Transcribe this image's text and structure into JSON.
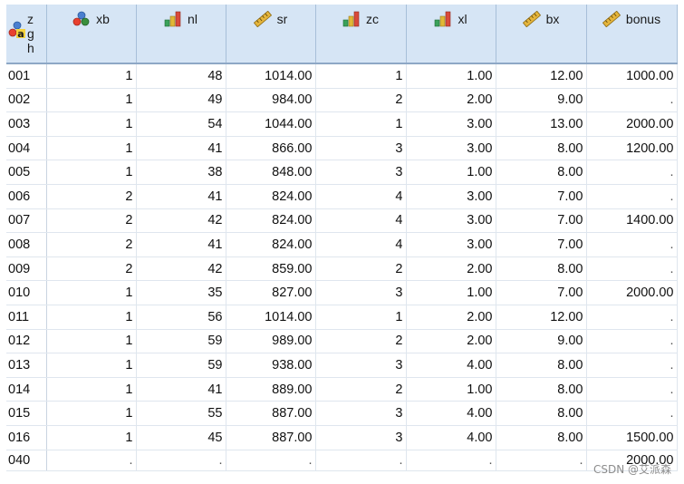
{
  "colors": {
    "header_bg": "#d6e5f5",
    "grid_line": "#dfe6ee",
    "nominal_icon": [
      "#e8402f",
      "#3a8f3d",
      "#4a7fd0"
    ],
    "ordinal_bar_colors": [
      "#3aa15a",
      "#e0b836",
      "#d94a3a"
    ],
    "scale_icon": "#e5b53c"
  },
  "header": {
    "corner_text": [
      "z",
      "g",
      "h"
    ],
    "corner_icon": "string-nominal-icon",
    "columns": [
      {
        "label": "xb",
        "icon": "nominal-icon"
      },
      {
        "label": "nl",
        "icon": "ordinal-icon"
      },
      {
        "label": "sr",
        "icon": "scale-ruler-icon"
      },
      {
        "label": "zc",
        "icon": "ordinal-icon"
      },
      {
        "label": "xl",
        "icon": "ordinal-icon"
      },
      {
        "label": "bx",
        "icon": "scale-ruler-icon"
      },
      {
        "label": "bonus",
        "icon": "scale-ruler-icon"
      }
    ]
  },
  "rows": [
    [
      "001",
      "1",
      "48",
      "1014.00",
      "1",
      "1.00",
      "12.00",
      "1000.00"
    ],
    [
      "002",
      "1",
      "49",
      "984.00",
      "2",
      "2.00",
      "9.00",
      "."
    ],
    [
      "003",
      "1",
      "54",
      "1044.00",
      "1",
      "3.00",
      "13.00",
      "2000.00"
    ],
    [
      "004",
      "1",
      "41",
      "866.00",
      "3",
      "3.00",
      "8.00",
      "1200.00"
    ],
    [
      "005",
      "1",
      "38",
      "848.00",
      "3",
      "1.00",
      "8.00",
      "."
    ],
    [
      "006",
      "2",
      "41",
      "824.00",
      "4",
      "3.00",
      "7.00",
      "."
    ],
    [
      "007",
      "2",
      "42",
      "824.00",
      "4",
      "3.00",
      "7.00",
      "1400.00"
    ],
    [
      "008",
      "2",
      "41",
      "824.00",
      "4",
      "3.00",
      "7.00",
      "."
    ],
    [
      "009",
      "2",
      "42",
      "859.00",
      "2",
      "2.00",
      "8.00",
      "."
    ],
    [
      "010",
      "1",
      "35",
      "827.00",
      "3",
      "1.00",
      "7.00",
      "2000.00"
    ],
    [
      "011",
      "1",
      "56",
      "1014.00",
      "1",
      "2.00",
      "12.00",
      "."
    ],
    [
      "012",
      "1",
      "59",
      "989.00",
      "2",
      "2.00",
      "9.00",
      "."
    ],
    [
      "013",
      "1",
      "59",
      "938.00",
      "3",
      "4.00",
      "8.00",
      "."
    ],
    [
      "014",
      "1",
      "41",
      "889.00",
      "2",
      "1.00",
      "8.00",
      "."
    ],
    [
      "015",
      "1",
      "55",
      "887.00",
      "3",
      "4.00",
      "8.00",
      "."
    ],
    [
      "016",
      "1",
      "45",
      "887.00",
      "3",
      "4.00",
      "8.00",
      "1500.00"
    ],
    [
      "040",
      ".",
      ".",
      ".",
      ".",
      ".",
      ".",
      "2000.00"
    ]
  ],
  "watermark": "CSDN @艾派森"
}
